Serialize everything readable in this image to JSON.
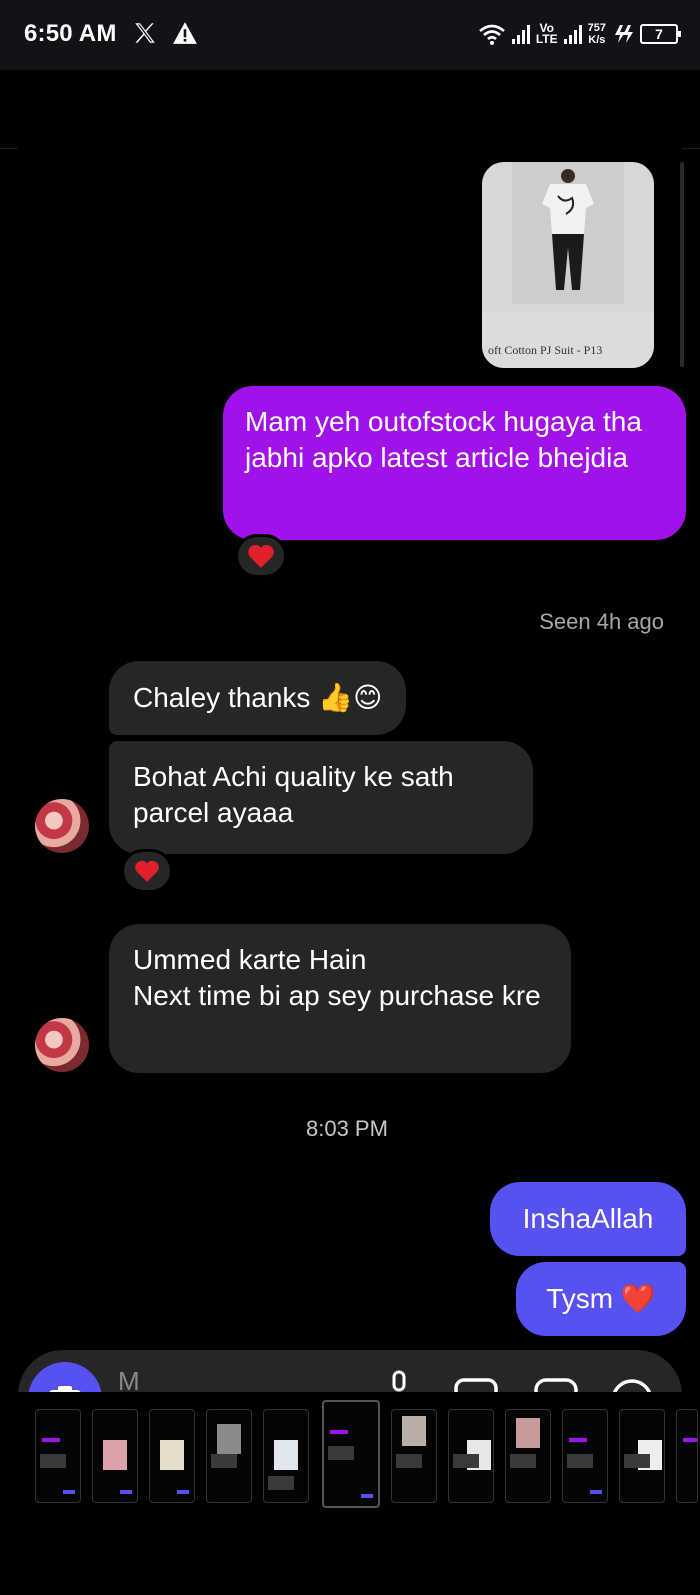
{
  "status_bar": {
    "time": "6:50 AM",
    "x_icon": "x-logo-icon",
    "alert_icon": "warning-icon",
    "volte_top": "Vo",
    "volte_bottom": "LTE",
    "speed_value": "757",
    "speed_unit": "K/s",
    "battery_level": "7"
  },
  "messages": {
    "product_card": {
      "caption": "oft Cotton PJ Suit - P13"
    },
    "outgoing_1": "Mam yeh outofstock hugaya tha jabhi apko latest article bhejdia",
    "outgoing_1_reaction": "❤️",
    "seen_status": "Seen 4h ago",
    "incoming_1": "Chaley thanks 👍😊",
    "incoming_2": "Bohat Achi quality ke sath parcel ayaaa",
    "incoming_2_reaction": "❤️",
    "incoming_3_line1": "Ummed karte Hain",
    "incoming_3_line2": "Next time bi ap sey purchase kre",
    "timestamp": "8:03 PM",
    "outgoing_2": "InshaAllah",
    "outgoing_3": "Tysm ❤️"
  },
  "composer": {
    "placeholder": "M"
  },
  "colors": {
    "outgoing_purple": "#a112ea",
    "outgoing_blue": "#5751f0",
    "incoming": "#262628",
    "background": "#000000"
  }
}
